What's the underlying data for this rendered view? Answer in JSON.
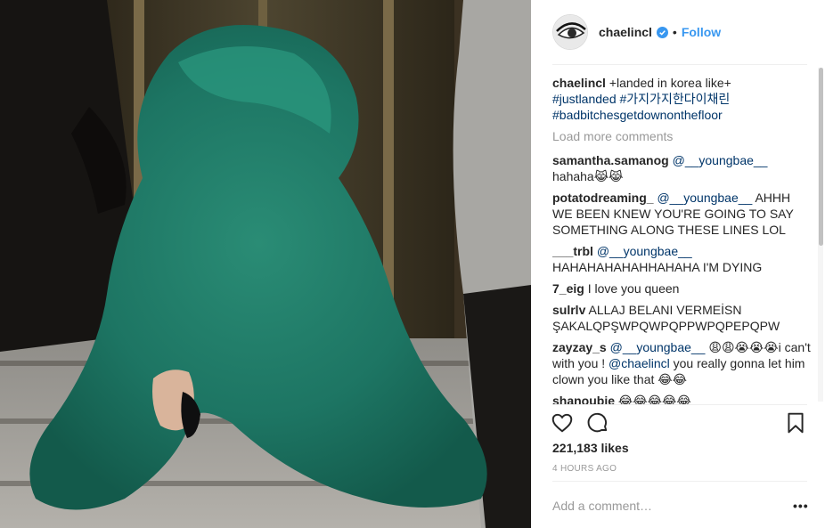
{
  "header": {
    "username": "chaelincl",
    "dot": "•",
    "follow_label": "Follow"
  },
  "caption": {
    "username": "chaelincl",
    "text": "+landed in korea like+",
    "tags": [
      "#justlanded",
      "#가지가지한다이채린",
      "#badbitchesgetdownonthefloor"
    ]
  },
  "load_more_label": "Load more comments",
  "comments": [
    {
      "user": "samantha.samanog",
      "mention": "@__youngbae__",
      "text": "hahaha😹😹"
    },
    {
      "user": "potatodreaming_",
      "mention": "@__youngbae__",
      "text": "AHHH WE BEEN KNEW YOU'RE GOING TO SAY SOMETHING ALONG THESE LINES LOL"
    },
    {
      "user": "___trbl",
      "mention": "@__youngbae__",
      "text": "HAHAHAHAHAHHAHAHA I'M DYING"
    },
    {
      "user": "7_eig",
      "mention": "",
      "text": "I love you queen"
    },
    {
      "user": "sulrlv",
      "mention": "",
      "text": "ALLAJ BELANI VERMEİSN ŞAKALQPŞWPQWPQPPWPQPEPQPW"
    },
    {
      "user": "zayzay_s",
      "mention": "@__youngbae__",
      "text": "😩😩😭😭😭i can't with you ! ",
      "mention2": "@chaelincl",
      "text2": "you really gonna let him clown you like that 😂😂"
    },
    {
      "user": "shanoubie",
      "mention": "",
      "text": "😂😂😂😂😂"
    }
  ],
  "likes": "221,183 likes",
  "time": "4 HOURS AGO",
  "add_comment_placeholder": "Add a comment…",
  "menu_label": "•••",
  "icons": {
    "like": "heart-icon",
    "comment": "comment-icon",
    "save": "bookmark-icon",
    "verified": "verified-badge-icon"
  },
  "colors": {
    "follow": "#3897f0",
    "hashtag": "#003569",
    "muted": "#999999",
    "fur": "#1e7a66"
  }
}
